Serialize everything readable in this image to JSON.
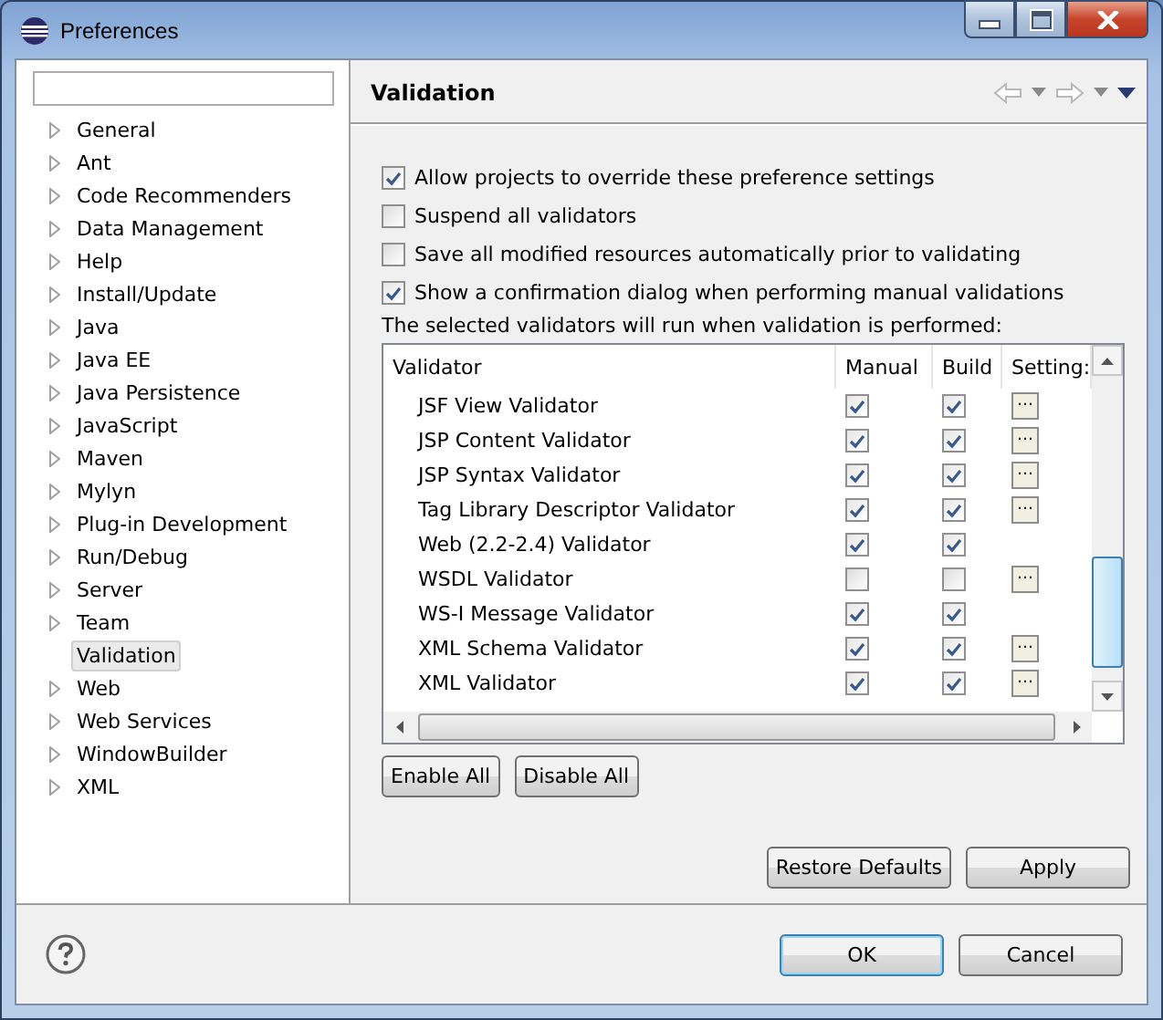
{
  "window": {
    "title": "Preferences"
  },
  "tree": [
    {
      "label": "General",
      "expandable": true,
      "selected": false
    },
    {
      "label": "Ant",
      "expandable": true,
      "selected": false
    },
    {
      "label": "Code Recommenders",
      "expandable": true,
      "selected": false
    },
    {
      "label": "Data Management",
      "expandable": true,
      "selected": false
    },
    {
      "label": "Help",
      "expandable": true,
      "selected": false
    },
    {
      "label": "Install/Update",
      "expandable": true,
      "selected": false
    },
    {
      "label": "Java",
      "expandable": true,
      "selected": false
    },
    {
      "label": "Java EE",
      "expandable": true,
      "selected": false
    },
    {
      "label": "Java Persistence",
      "expandable": true,
      "selected": false
    },
    {
      "label": "JavaScript",
      "expandable": true,
      "selected": false
    },
    {
      "label": "Maven",
      "expandable": true,
      "selected": false
    },
    {
      "label": "Mylyn",
      "expandable": true,
      "selected": false
    },
    {
      "label": "Plug-in Development",
      "expandable": true,
      "selected": false
    },
    {
      "label": "Run/Debug",
      "expandable": true,
      "selected": false
    },
    {
      "label": "Server",
      "expandable": true,
      "selected": false
    },
    {
      "label": "Team",
      "expandable": true,
      "selected": false
    },
    {
      "label": "Validation",
      "expandable": false,
      "selected": true
    },
    {
      "label": "Web",
      "expandable": true,
      "selected": false
    },
    {
      "label": "Web Services",
      "expandable": true,
      "selected": false
    },
    {
      "label": "WindowBuilder",
      "expandable": true,
      "selected": false
    },
    {
      "label": "XML",
      "expandable": true,
      "selected": false
    }
  ],
  "page": {
    "title": "Validation",
    "options": [
      {
        "label": "Allow projects to override these preference settings",
        "checked": true
      },
      {
        "label": "Suspend all validators",
        "checked": false
      },
      {
        "label": "Save all modified resources automatically prior to validating",
        "checked": false
      },
      {
        "label": "Show a confirmation dialog when performing manual validations",
        "checked": true
      }
    ],
    "note": "The selected validators will run when validation is performed:",
    "table": {
      "columns": [
        "Validator",
        "Manual",
        "Build",
        "Setting:"
      ],
      "rows": [
        {
          "name": "JSF View Validator",
          "manual": true,
          "build": true,
          "settings": "…"
        },
        {
          "name": "JSP Content Validator",
          "manual": true,
          "build": true,
          "settings": "…"
        },
        {
          "name": "JSP Syntax Validator",
          "manual": true,
          "build": true,
          "settings": "…"
        },
        {
          "name": "Tag Library Descriptor Validator",
          "manual": true,
          "build": true,
          "settings": "…"
        },
        {
          "name": "Web (2.2-2.4) Validator",
          "manual": true,
          "build": true
        },
        {
          "name": "WSDL Validator",
          "manual": false,
          "build": false,
          "settings": "…"
        },
        {
          "name": "WS-I Message Validator",
          "manual": true,
          "build": true
        },
        {
          "name": "XML Schema Validator",
          "manual": true,
          "build": true,
          "settings": "…"
        },
        {
          "name": "XML Validator",
          "manual": true,
          "build": true,
          "settings": "…"
        }
      ]
    },
    "table_buttons": [
      "Enable All",
      "Disable All"
    ],
    "page_buttons": [
      "Restore Defaults",
      "Apply"
    ]
  },
  "buttons": [
    {
      "label": "OK",
      "default": true
    },
    {
      "label": "Cancel",
      "default": false
    }
  ]
}
